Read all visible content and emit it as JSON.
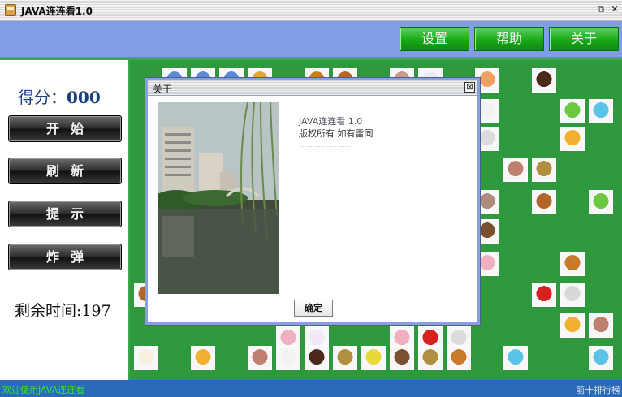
{
  "window": {
    "title": "JAVA连连看1.0",
    "icon": "cup-icon",
    "controls": {
      "restore_icon": "⧉",
      "close_icon": "✕"
    }
  },
  "menu": {
    "settings_label": "设置",
    "help_label": "帮助",
    "about_label": "关于"
  },
  "side": {
    "score_label": "得分：",
    "score_value": "000",
    "start_label": "开始",
    "refresh_label": "刷新",
    "hint_label": "提示",
    "bomb_label": "炸弹",
    "timer_label": "剩余时间:",
    "timer_value": "197"
  },
  "status": {
    "left": "欢迎使用JAVA连连看",
    "right": "前十排行榜"
  },
  "dialog": {
    "title": "关于",
    "close_icon": "⊠",
    "line1": "JAVA连连看 1.0",
    "line2": "版权所有  如有雷同",
    "ok_label": "确定"
  },
  "colors": {
    "board": "#2f9a3d",
    "menu_bg": "#7f9ee6",
    "status_bg": "#2a6ab8",
    "status_text": "#2fe82f"
  },
  "board": {
    "tiles": [
      {
        "icon": "blue-tile",
        "color": "#5c8ad6"
      },
      {
        "icon": "blue-tile",
        "color": "#5c8ad6"
      },
      {
        "icon": "blue-tile",
        "color": "#5c8ad6"
      },
      {
        "icon": "fire-tile",
        "color": "#e8a23a"
      },
      {
        "icon": "tiger-tile",
        "color": "#c87a2a"
      },
      {
        "icon": "burger-tile",
        "color": "#b5652a"
      },
      {
        "icon": "girl-tile",
        "color": "#c79a8a"
      },
      {
        "icon": "bunny-tile",
        "color": "#f2e8f8"
      },
      {
        "icon": "icecream-tile",
        "color": "#f0a060"
      },
      {
        "icon": "cake-tile",
        "color": "#4a2a1a"
      },
      {
        "icon": "apple-green-tile",
        "color": "#6bc840"
      },
      {
        "icon": "butterfly-tile",
        "color": "#59c4e8"
      },
      {
        "icon": "bunny-tile",
        "color": "#f2f2f2"
      },
      {
        "icon": "panda-tile",
        "color": "#dcdcdc"
      },
      {
        "icon": "apple-gold-tile",
        "color": "#f0b030"
      },
      {
        "icon": "girl-tile",
        "color": "#c08070"
      },
      {
        "icon": "monkey-tile",
        "color": "#b09040"
      },
      {
        "icon": "boy-tile",
        "color": "#b08a7a"
      },
      {
        "icon": "burger-tile",
        "color": "#b5652a"
      },
      {
        "icon": "apple-green-tile",
        "color": "#6bc840"
      },
      {
        "icon": "dog-tile",
        "color": "#7a5030"
      },
      {
        "icon": "pig-tile",
        "color": "#f0b0c0"
      },
      {
        "icon": "tiger-tile",
        "color": "#c87a2a"
      },
      {
        "icon": "dog-tile",
        "color": "#d8d8d8"
      },
      {
        "icon": "heart-tile",
        "color": "#d82020"
      },
      {
        "icon": "apple-gold-tile",
        "color": "#f0b030"
      },
      {
        "icon": "girl-tile",
        "color": "#c08070"
      },
      {
        "icon": "burger-tile",
        "color": "#b5652a"
      },
      {
        "icon": "pig-tile",
        "color": "#f0b0c0"
      },
      {
        "icon": "bunny-tile",
        "color": "#f2e8f8"
      },
      {
        "icon": "pig-tile",
        "color": "#f0b0c0"
      },
      {
        "icon": "heart-tile",
        "color": "#d82020"
      },
      {
        "icon": "panda-tile",
        "color": "#dcdcdc"
      },
      {
        "icon": "bunny-tile",
        "color": "#f6f0e0"
      },
      {
        "icon": "apple-gold-tile",
        "color": "#f0b030"
      },
      {
        "icon": "girl-tile",
        "color": "#c08070"
      },
      {
        "icon": "bunny-tile",
        "color": "#f2f2f2"
      },
      {
        "icon": "cake-tile",
        "color": "#4a2a1a"
      },
      {
        "icon": "monkey-tile",
        "color": "#b09040"
      },
      {
        "icon": "lemon-tile",
        "color": "#e8d83a"
      },
      {
        "icon": "dog-tile",
        "color": "#7a5030"
      },
      {
        "icon": "monkey-tile",
        "color": "#b09040"
      },
      {
        "icon": "tiger-tile",
        "color": "#c87a2a"
      },
      {
        "icon": "butterfly-tile",
        "color": "#59c4e8"
      },
      {
        "icon": "butterfly-tile",
        "color": "#59c4e8"
      }
    ]
  }
}
